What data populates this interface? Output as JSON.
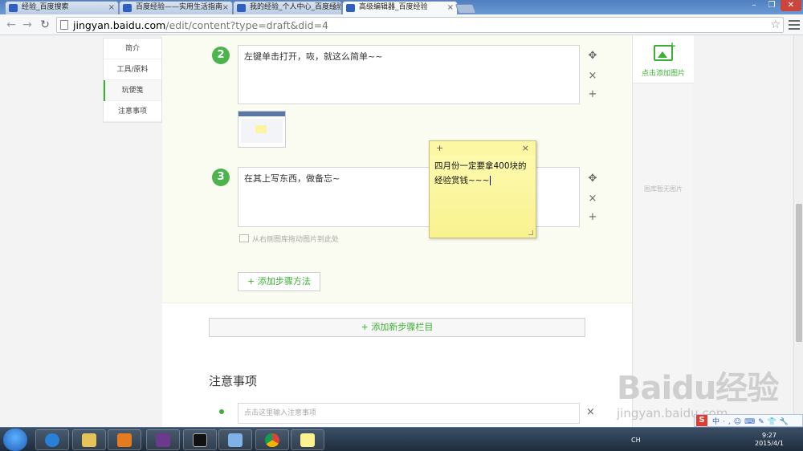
{
  "browser": {
    "tabs": [
      {
        "title": "经验_百度搜索",
        "active": false
      },
      {
        "title": "百度经验——实用生活指南",
        "active": false
      },
      {
        "title": "我的经验_个人中心_百度经验",
        "active": false
      },
      {
        "title": "高级编辑器_百度经验",
        "active": true
      }
    ],
    "url_host": "jingyan.baidu.com",
    "url_path": "/edit/content?type=draft&did=4"
  },
  "sidebar": {
    "items": [
      {
        "label": "简介"
      },
      {
        "label": "工具/原料"
      },
      {
        "label": "玩便笺"
      },
      {
        "label": "注意事项"
      }
    ]
  },
  "steps": [
    {
      "number": "2",
      "text": "左键单击打开，咴，就这么简单~~"
    },
    {
      "number": "3",
      "text": "在其上写东西，做备忘~"
    }
  ],
  "drag_hint": "从右侧图库拖动图片到此处",
  "add_method_label": "+ 添加步骤方法",
  "add_section_label": "+ 添加新步骤栏目",
  "notes": {
    "title": "注意事项",
    "placeholder": "点击这里输入注意事项"
  },
  "gallery": {
    "add_label": "点击添加图片",
    "empty_text": "图库暂无图片"
  },
  "sticky_note": {
    "text_line1": "四月份一定要拿400块的",
    "text_line2": "经验赏钱~~~"
  },
  "watermark": {
    "logo": "Baidu经验",
    "sub": "jingyan.baidu.com"
  },
  "taskbar": {
    "lang": "CH",
    "time": "9:27",
    "date": "2015/4/1"
  },
  "colors": {
    "accent_green": "#3cb034",
    "step_bg": "#fbfcf1",
    "sticky_yellow": "#fdfbb2"
  }
}
